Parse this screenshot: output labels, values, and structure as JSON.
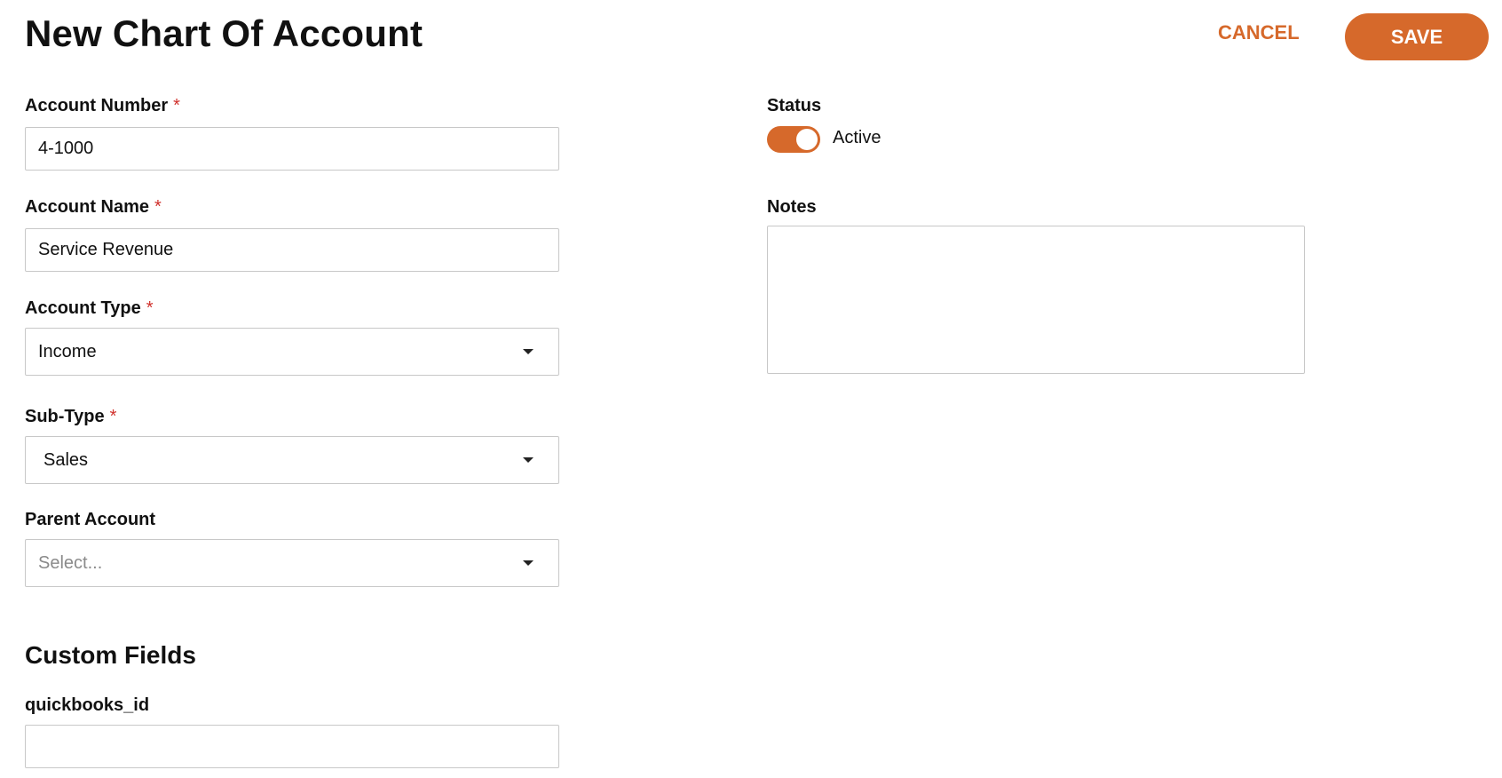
{
  "header": {
    "title": "New Chart Of Account",
    "cancel_label": "CANCEL",
    "save_label": "SAVE"
  },
  "form": {
    "account_number": {
      "label": "Account Number",
      "required_mark": "*",
      "value": "4-1000"
    },
    "account_name": {
      "label": "Account Name",
      "required_mark": "*",
      "value": "Service Revenue"
    },
    "account_type": {
      "label": "Account Type",
      "required_mark": "*",
      "value": "Income"
    },
    "sub_type": {
      "label": "Sub-Type",
      "required_mark": "*",
      "value": "Sales"
    },
    "parent_account": {
      "label": "Parent Account",
      "placeholder": "Select..."
    },
    "status": {
      "label": "Status",
      "value_label": "Active",
      "on": true
    },
    "notes": {
      "label": "Notes",
      "value": ""
    }
  },
  "custom_fields": {
    "title": "Custom Fields",
    "quickbooks_id": {
      "label": "quickbooks_id",
      "value": ""
    }
  },
  "colors": {
    "accent": "#d6692b",
    "required": "#d0302b",
    "border": "#c8c8c8"
  },
  "icons": {
    "select_caret": "caret-down-icon"
  }
}
